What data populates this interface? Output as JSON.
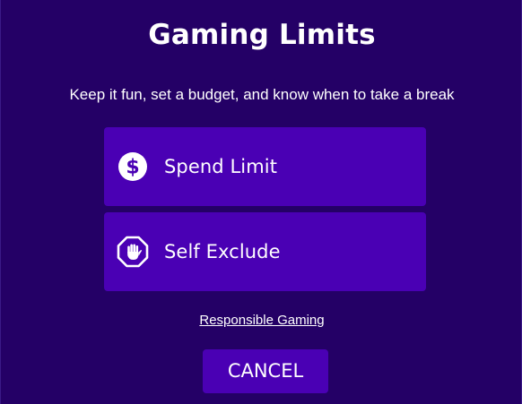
{
  "dialog": {
    "title": "Gaming Limits",
    "subtitle": "Keep it fun, set a budget, and know when to take a break"
  },
  "options": [
    {
      "label": "Spend Limit",
      "icon": "dollar-icon"
    },
    {
      "label": "Self Exclude",
      "icon": "stop-hand-icon"
    }
  ],
  "footer": {
    "link_label": "Responsible Gaming",
    "cancel_label": "CANCEL"
  },
  "colors": {
    "background": "#240066",
    "button": "#4a00b4",
    "text": "#ffffff"
  }
}
